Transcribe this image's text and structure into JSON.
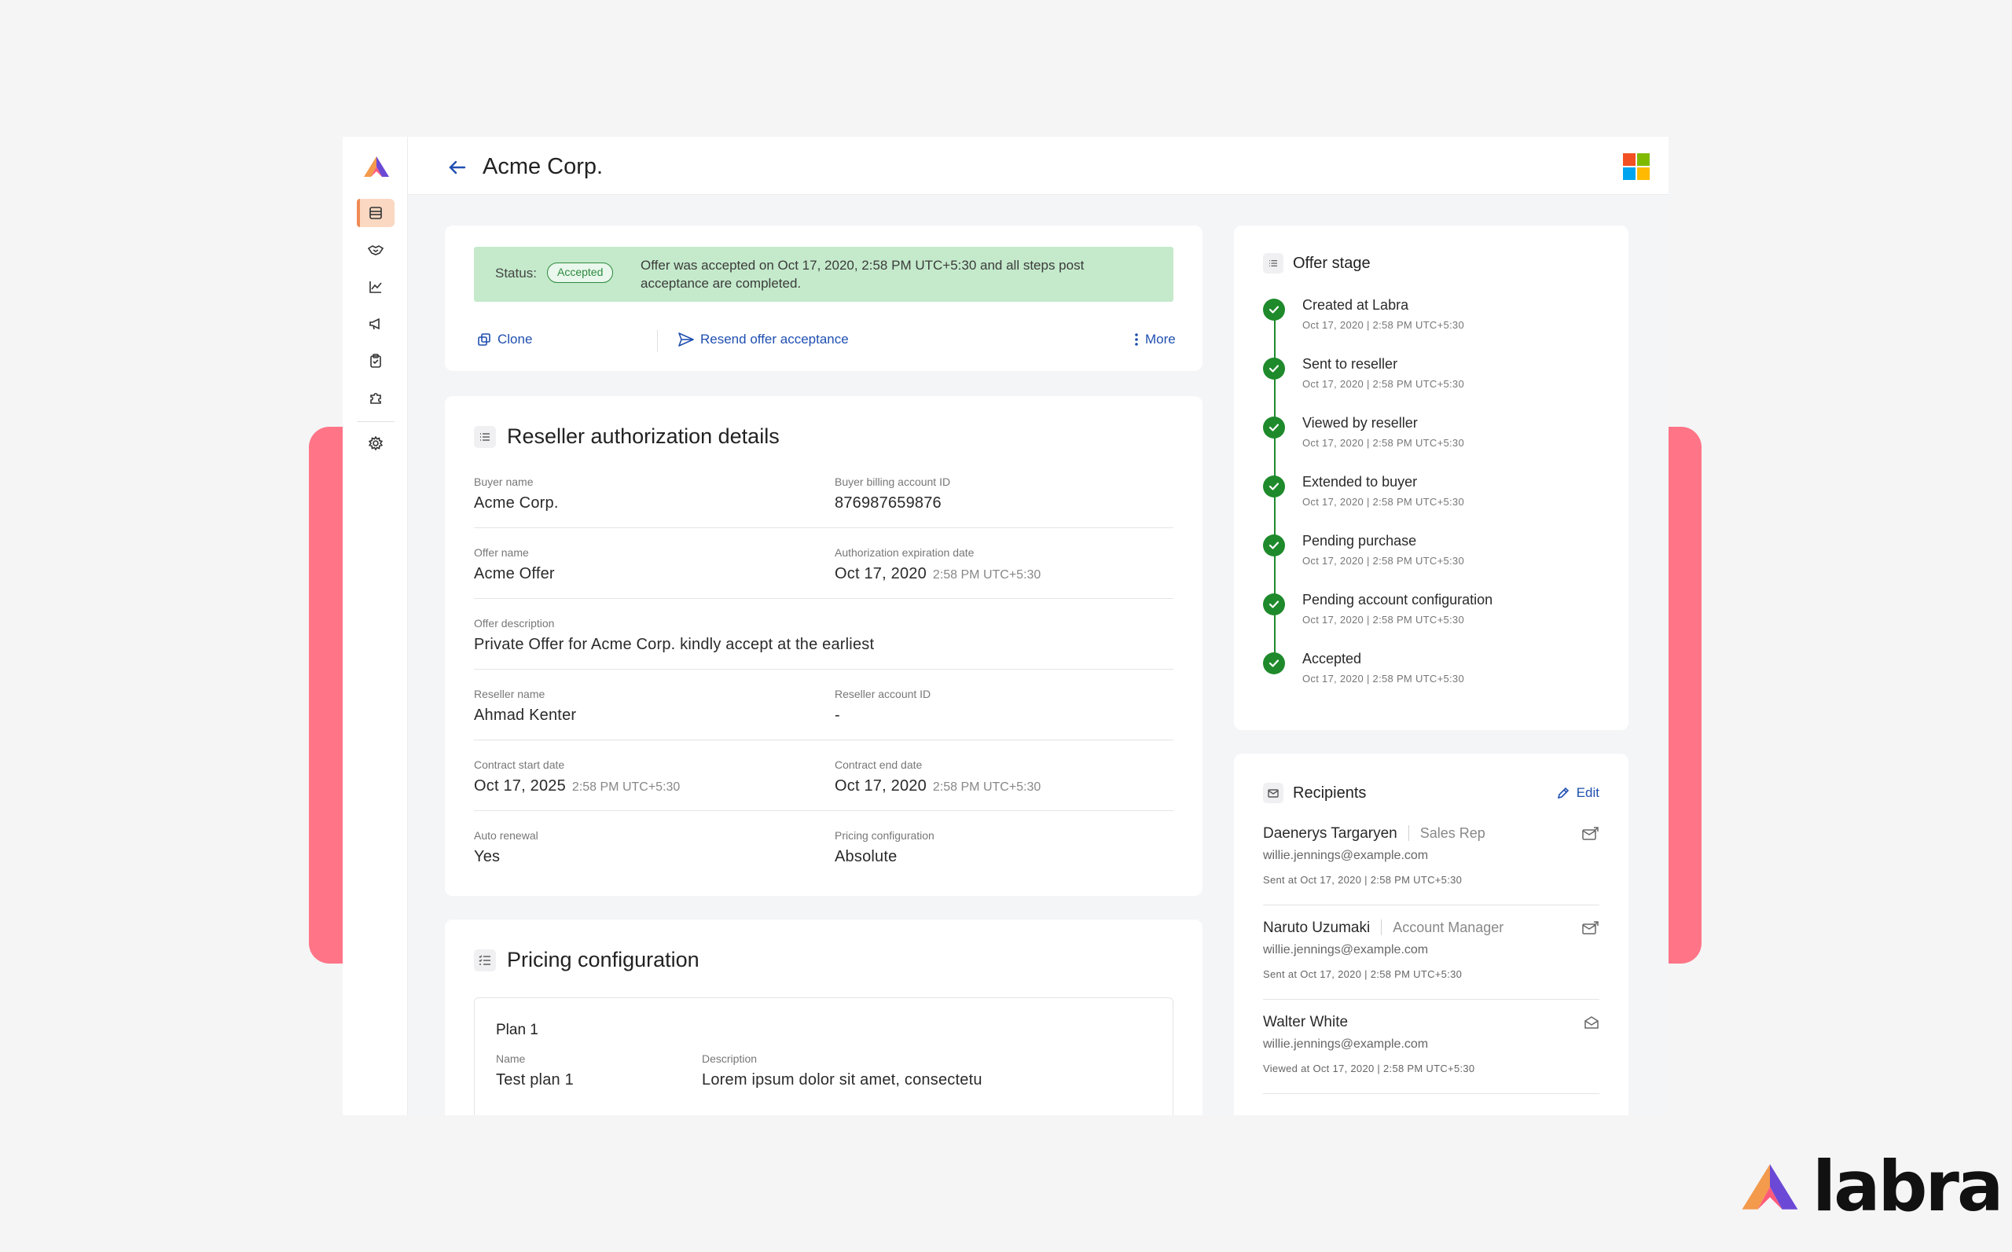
{
  "page": {
    "title": "Acme Corp."
  },
  "sidebar": {
    "items": [
      {
        "icon": "archive-icon"
      },
      {
        "icon": "handshake-icon"
      },
      {
        "icon": "line-chart-icon"
      },
      {
        "icon": "megaphone-icon"
      },
      {
        "icon": "clipboard-check-icon"
      },
      {
        "icon": "puzzle-icon"
      },
      {
        "icon": "gear-icon"
      }
    ]
  },
  "status": {
    "label": "Status:",
    "badge": "Accepted",
    "message": "Offer was accepted on Oct 17, 2020, 2:58 PM UTC+5:30 and all steps post acceptance are completed."
  },
  "actions": {
    "clone": "Clone",
    "resend": "Resend offer acceptance",
    "more": "More"
  },
  "details": {
    "title": "Reseller authorization details",
    "buyer_name": {
      "label": "Buyer name",
      "value": "Acme Corp."
    },
    "buyer_billing": {
      "label": "Buyer billing account ID",
      "value": "876987659876"
    },
    "offer_name": {
      "label": "Offer name",
      "value": "Acme Offer"
    },
    "auth_expiry": {
      "label": "Authorization expiration date",
      "value": "Oct 17, 2020",
      "time": "2:58 PM UTC+5:30"
    },
    "offer_description": {
      "label": "Offer description",
      "value": "Private Offer for Acme Corp. kindly accept at the earliest"
    },
    "reseller_name": {
      "label": "Reseller name",
      "value": "Ahmad Kenter"
    },
    "reseller_account": {
      "label": "Reseller account ID",
      "value": "-"
    },
    "contract_start": {
      "label": "Contract start date",
      "value": "Oct 17, 2025",
      "time": "2:58 PM UTC+5:30"
    },
    "contract_end": {
      "label": "Contract end date",
      "value": "Oct 17, 2020",
      "time": "2:58 PM UTC+5:30"
    },
    "auto_renewal": {
      "label": "Auto renewal",
      "value": "Yes"
    },
    "pricing_config": {
      "label": "Pricing configuration",
      "value": "Absolute"
    }
  },
  "pricing": {
    "title": "Pricing configuration",
    "plan": {
      "title": "Plan 1",
      "name_label": "Name",
      "name_value": "Test plan 1",
      "desc_label": "Description",
      "desc_value": "Lorem ipsum dolor sit amet, consectetu"
    }
  },
  "stage": {
    "title": "Offer stage",
    "items": [
      {
        "name": "Created at Labra",
        "time": "Oct 17, 2020 | 2:58 PM UTC+5:30"
      },
      {
        "name": "Sent to reseller",
        "time": "Oct 17, 2020 | 2:58 PM UTC+5:30"
      },
      {
        "name": "Viewed by reseller",
        "time": "Oct 17, 2020 | 2:58 PM UTC+5:30"
      },
      {
        "name": "Extended to buyer",
        "time": "Oct 17, 2020 | 2:58 PM UTC+5:30"
      },
      {
        "name": "Pending purchase",
        "time": "Oct 17, 2020 | 2:58 PM UTC+5:30"
      },
      {
        "name": "Pending account configuration",
        "time": "Oct 17, 2020 | 2:58 PM UTC+5:30"
      },
      {
        "name": "Accepted",
        "time": "Oct 17, 2020 | 2:58 PM UTC+5:30"
      }
    ]
  },
  "recipients": {
    "title": "Recipients",
    "edit": "Edit",
    "items": [
      {
        "name": "Daenerys Targaryen",
        "role": "Sales Rep",
        "email": "willie.jennings@example.com",
        "time": "Sent at Oct 17, 2020 | 2:58 PM UTC+5:30",
        "icon": "mail-sent-icon"
      },
      {
        "name": "Naruto Uzumaki",
        "role": "Account Manager",
        "email": "willie.jennings@example.com",
        "time": "Sent at Oct 17, 2020 | 2:58 PM UTC+5:30",
        "icon": "mail-sent-icon"
      },
      {
        "name": "Walter White",
        "role": "",
        "email": "willie.jennings@example.com",
        "time": "Viewed at Oct 17, 2020 | 2:58 PM UTC+5:30",
        "icon": "mail-open-icon"
      }
    ]
  },
  "brand": {
    "word": "labra"
  },
  "colors": {
    "accent": "#1f4fb0",
    "success": "#1e8a2b",
    "status_bg": "#c4eacb",
    "decor": "#ff7587",
    "nav_active": "#fbd8c2"
  }
}
